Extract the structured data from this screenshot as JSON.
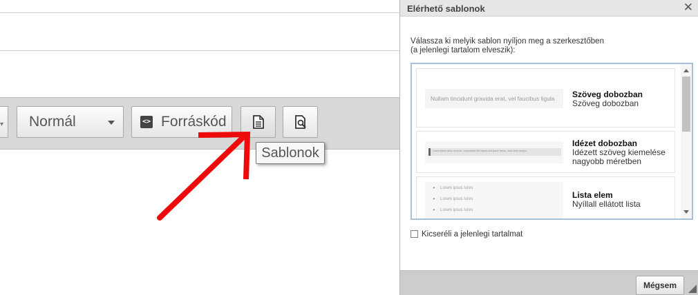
{
  "toolbar": {
    "format_label": "Normál",
    "source_label": "Forráskód",
    "templates_tooltip": "Sablonok",
    "icons": [
      "chevron-down-icon",
      "source-code-icon",
      "templates-icon",
      "preview-icon"
    ]
  },
  "dialog": {
    "title": "Elérhető sablonok",
    "close_glyph": "✕",
    "intro_line1": "Válassza ki melyik sablon nyíljon meg a szerkesztőben",
    "intro_line2": "(a jelenlegi tartalom elveszik):",
    "templates": [
      {
        "name": "Szöveg dobozban",
        "desc": "Szöveg dobozban",
        "thumb_text": "Nullam tincidunt gravida erat, vel faucibus ligula"
      },
      {
        "name": "Idézet dobozban",
        "desc": "Idézett szöveg kiemelése nagyobb méretben",
        "thumb_text": "Lorem ipsum dolor sit amet, consectetur elit mauris sed ipsum lectus, nunc ante, tempor"
      },
      {
        "name": "Lista elem",
        "desc": "Nyíllall ellátott lista",
        "thumb_items": [
          "Lorem ipsus lures",
          "Lorem ipsus lures",
          "Lorem ipsus lures"
        ]
      }
    ],
    "replace_label": "Kicseréli a jelenlegi tartalmat",
    "cancel_label": "Mégsem"
  },
  "colors": {
    "annotation_arrow": "#ee0a0a",
    "list_border": "#a9c0dd"
  }
}
